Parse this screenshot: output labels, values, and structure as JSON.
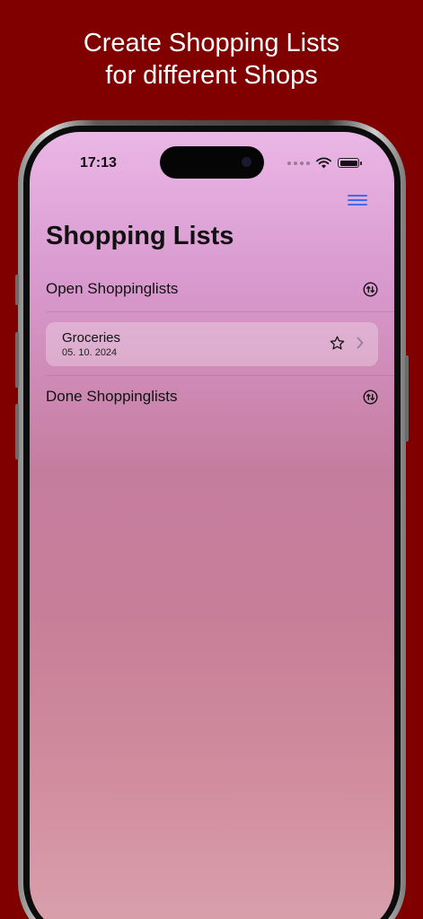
{
  "headline": {
    "line1": "Create Shopping Lists",
    "line2": "for different Shops"
  },
  "status_bar": {
    "time": "17:13"
  },
  "colors": {
    "background": "#800000",
    "accent": "#3a6cf0"
  },
  "app": {
    "title": "Shopping Lists",
    "menu_icon": "hamburger-menu-icon",
    "sections": [
      {
        "label": "Open Shoppinglists",
        "sort_icon": "sort-arrows-icon",
        "items": [
          {
            "name": "Groceries",
            "date": "05. 10. 2024",
            "favorite_icon": "star-outline-icon",
            "disclosure_icon": "chevron-right-icon"
          }
        ]
      },
      {
        "label": "Done Shoppinglists",
        "sort_icon": "sort-arrows-icon",
        "items": []
      }
    ]
  }
}
